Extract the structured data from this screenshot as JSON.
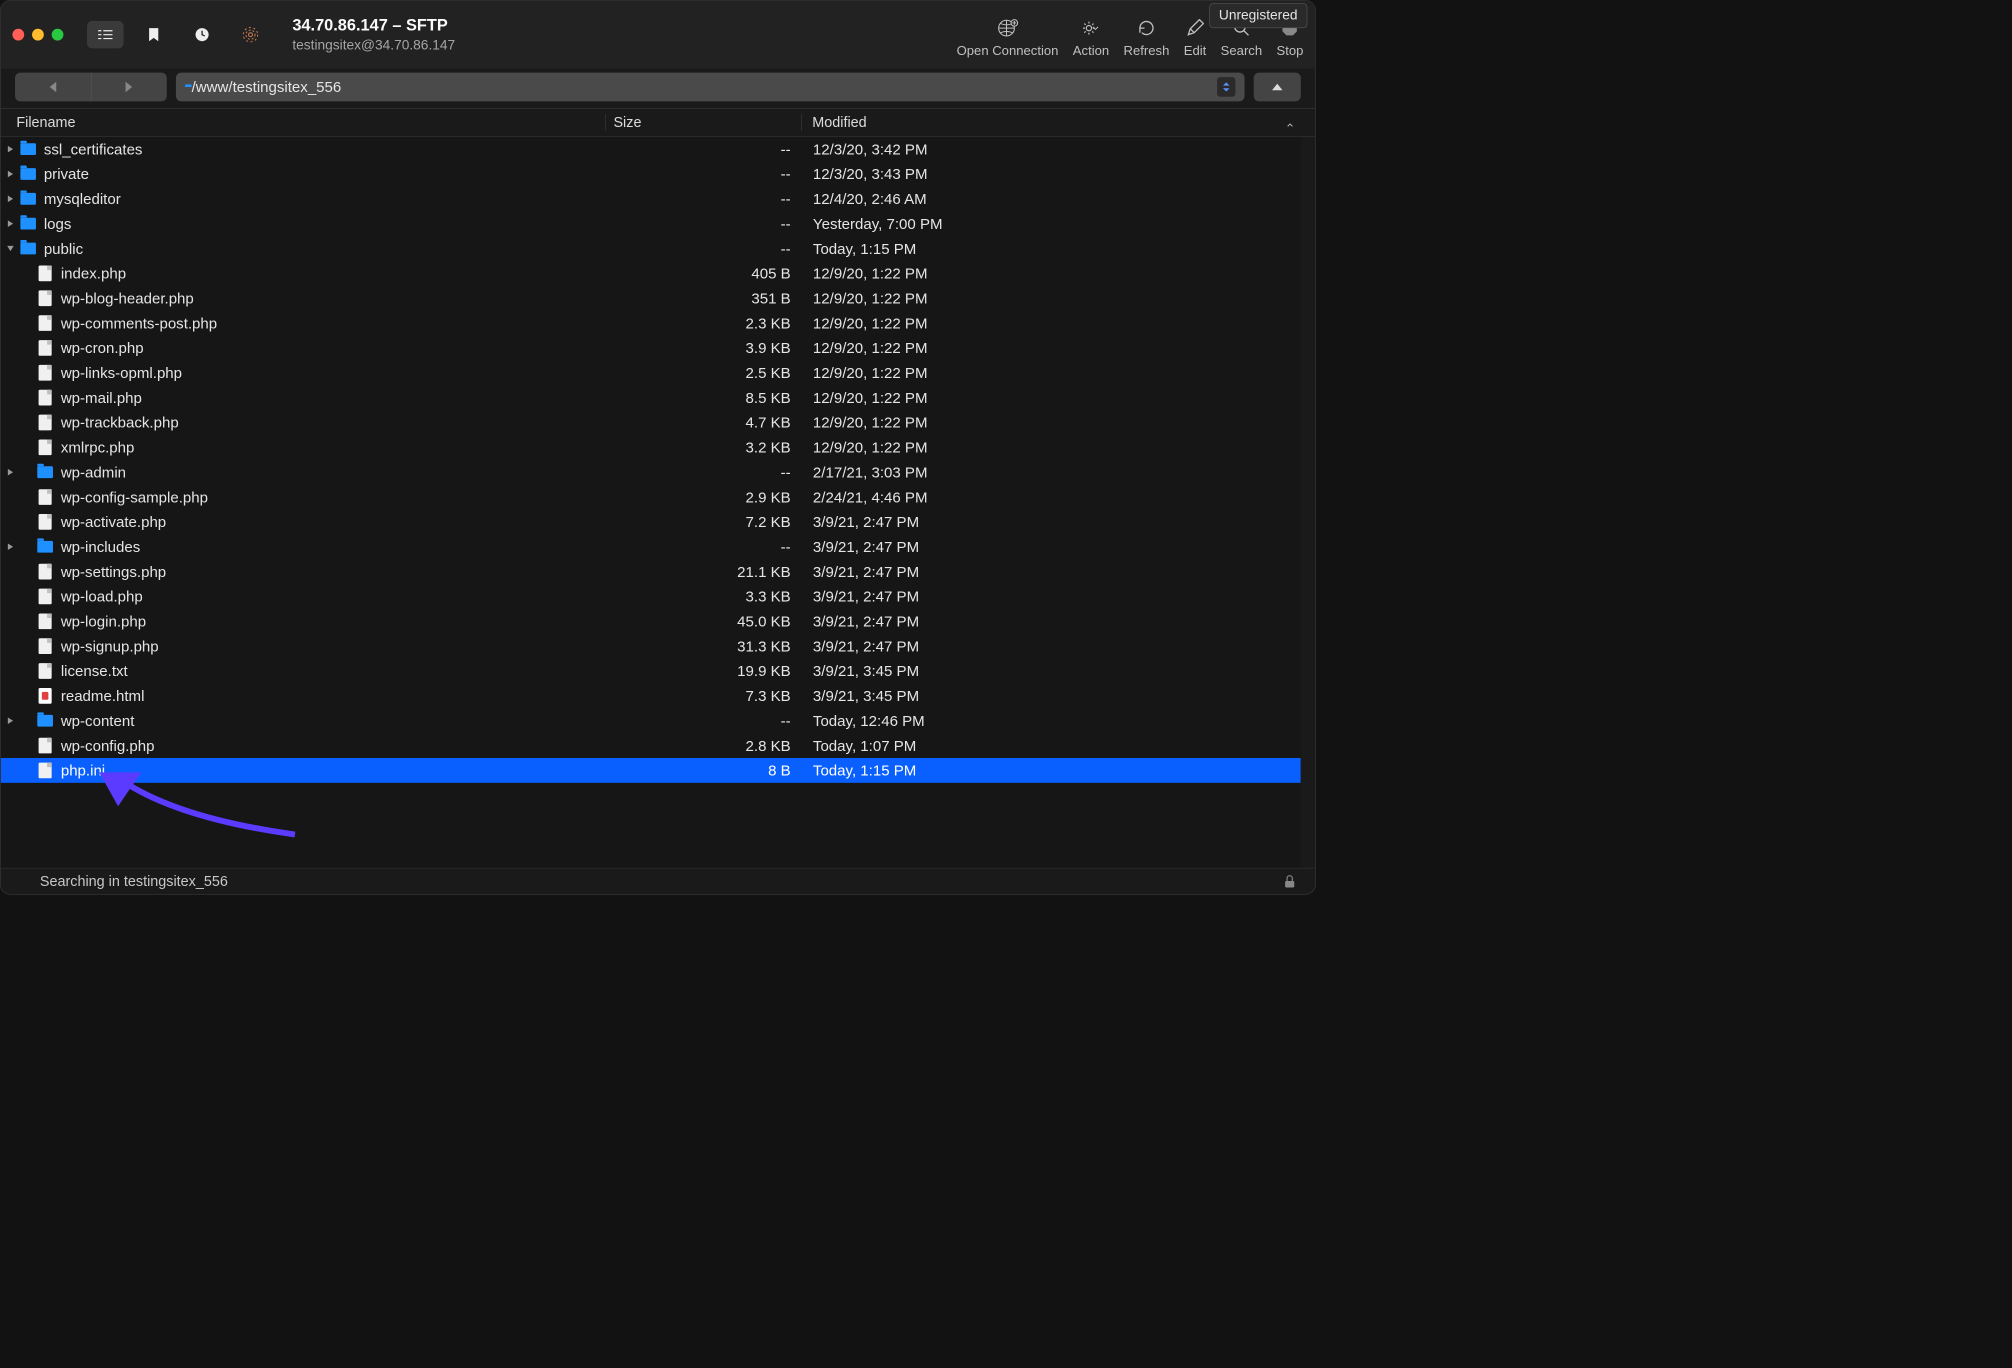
{
  "unregistered_label": "Unregistered",
  "title": "34.70.86.147 – SFTP",
  "subtitle": "testingsitex@34.70.86.147",
  "actions": {
    "open": "Open Connection",
    "action": "Action",
    "refresh": "Refresh",
    "edit": "Edit",
    "search": "Search",
    "stop": "Stop"
  },
  "path": "/www/testingsitex_556",
  "columns": {
    "filename": "Filename",
    "size": "Size",
    "modified": "Modified"
  },
  "rows": [
    {
      "name": "ssl_certificates",
      "type": "folder",
      "size": "--",
      "mod": "12/3/20, 3:42 PM",
      "depth": 0,
      "disc": "closed"
    },
    {
      "name": "private",
      "type": "folder",
      "size": "--",
      "mod": "12/3/20, 3:43 PM",
      "depth": 0,
      "disc": "closed"
    },
    {
      "name": "mysqleditor",
      "type": "folder",
      "size": "--",
      "mod": "12/4/20, 2:46 AM",
      "depth": 0,
      "disc": "closed"
    },
    {
      "name": "logs",
      "type": "folder",
      "size": "--",
      "mod": "Yesterday, 7:00 PM",
      "depth": 0,
      "disc": "closed"
    },
    {
      "name": "public",
      "type": "folder",
      "size": "--",
      "mod": "Today, 1:15 PM",
      "depth": 0,
      "disc": "open"
    },
    {
      "name": "index.php",
      "type": "file",
      "size": "405 B",
      "mod": "12/9/20, 1:22 PM",
      "depth": 1
    },
    {
      "name": "wp-blog-header.php",
      "type": "file",
      "size": "351 B",
      "mod": "12/9/20, 1:22 PM",
      "depth": 1
    },
    {
      "name": "wp-comments-post.php",
      "type": "file",
      "size": "2.3 KB",
      "mod": "12/9/20, 1:22 PM",
      "depth": 1
    },
    {
      "name": "wp-cron.php",
      "type": "file",
      "size": "3.9 KB",
      "mod": "12/9/20, 1:22 PM",
      "depth": 1
    },
    {
      "name": "wp-links-opml.php",
      "type": "file",
      "size": "2.5 KB",
      "mod": "12/9/20, 1:22 PM",
      "depth": 1
    },
    {
      "name": "wp-mail.php",
      "type": "file",
      "size": "8.5 KB",
      "mod": "12/9/20, 1:22 PM",
      "depth": 1
    },
    {
      "name": "wp-trackback.php",
      "type": "file",
      "size": "4.7 KB",
      "mod": "12/9/20, 1:22 PM",
      "depth": 1
    },
    {
      "name": "xmlrpc.php",
      "type": "file",
      "size": "3.2 KB",
      "mod": "12/9/20, 1:22 PM",
      "depth": 1
    },
    {
      "name": "wp-admin",
      "type": "folder",
      "size": "--",
      "mod": "2/17/21, 3:03 PM",
      "depth": 1,
      "disc": "closed"
    },
    {
      "name": "wp-config-sample.php",
      "type": "file",
      "size": "2.9 KB",
      "mod": "2/24/21, 4:46 PM",
      "depth": 1
    },
    {
      "name": "wp-activate.php",
      "type": "file",
      "size": "7.2 KB",
      "mod": "3/9/21, 2:47 PM",
      "depth": 1
    },
    {
      "name": "wp-includes",
      "type": "folder",
      "size": "--",
      "mod": "3/9/21, 2:47 PM",
      "depth": 1,
      "disc": "closed"
    },
    {
      "name": "wp-settings.php",
      "type": "file",
      "size": "21.1 KB",
      "mod": "3/9/21, 2:47 PM",
      "depth": 1
    },
    {
      "name": "wp-load.php",
      "type": "file",
      "size": "3.3 KB",
      "mod": "3/9/21, 2:47 PM",
      "depth": 1
    },
    {
      "name": "wp-login.php",
      "type": "file",
      "size": "45.0 KB",
      "mod": "3/9/21, 2:47 PM",
      "depth": 1
    },
    {
      "name": "wp-signup.php",
      "type": "file",
      "size": "31.3 KB",
      "mod": "3/9/21, 2:47 PM",
      "depth": 1
    },
    {
      "name": "license.txt",
      "type": "file",
      "size": "19.9 KB",
      "mod": "3/9/21, 3:45 PM",
      "depth": 1
    },
    {
      "name": "readme.html",
      "type": "html",
      "size": "7.3 KB",
      "mod": "3/9/21, 3:45 PM",
      "depth": 1
    },
    {
      "name": "wp-content",
      "type": "folder",
      "size": "--",
      "mod": "Today, 12:46 PM",
      "depth": 1,
      "disc": "closed"
    },
    {
      "name": "wp-config.php",
      "type": "file",
      "size": "2.8 KB",
      "mod": "Today, 1:07 PM",
      "depth": 1
    },
    {
      "name": "php.ini",
      "type": "file",
      "size": "8 B",
      "mod": "Today, 1:15 PM",
      "depth": 1,
      "selected": true
    }
  ],
  "status": "Searching in testingsitex_556"
}
